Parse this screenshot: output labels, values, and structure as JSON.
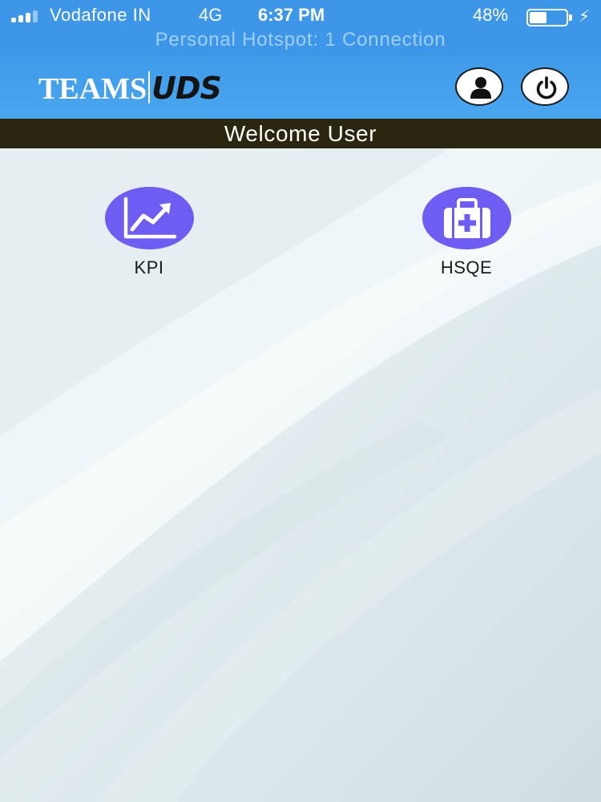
{
  "status_bar": {
    "carrier": "Vodafone IN",
    "network": "4G",
    "time": "6:37 PM",
    "battery_percent": "48%",
    "battery_level": 0.48,
    "hotspot": "Personal Hotspot: 1 Connection"
  },
  "header": {
    "logo_left": "TEAMS",
    "logo_right": "UDS",
    "profile_icon": "user-icon",
    "power_icon": "power-icon"
  },
  "welcome": "Welcome User",
  "tiles": [
    {
      "label": "KPI",
      "icon": "chart-trending-up-icon"
    },
    {
      "label": "HSQE",
      "icon": "first-aid-kit-icon"
    }
  ],
  "colors": {
    "status_bar": "#3e96e8",
    "header": "#45a2ed",
    "welcome_bar": "#2a2610",
    "tile_circle": "#6e5df2"
  }
}
